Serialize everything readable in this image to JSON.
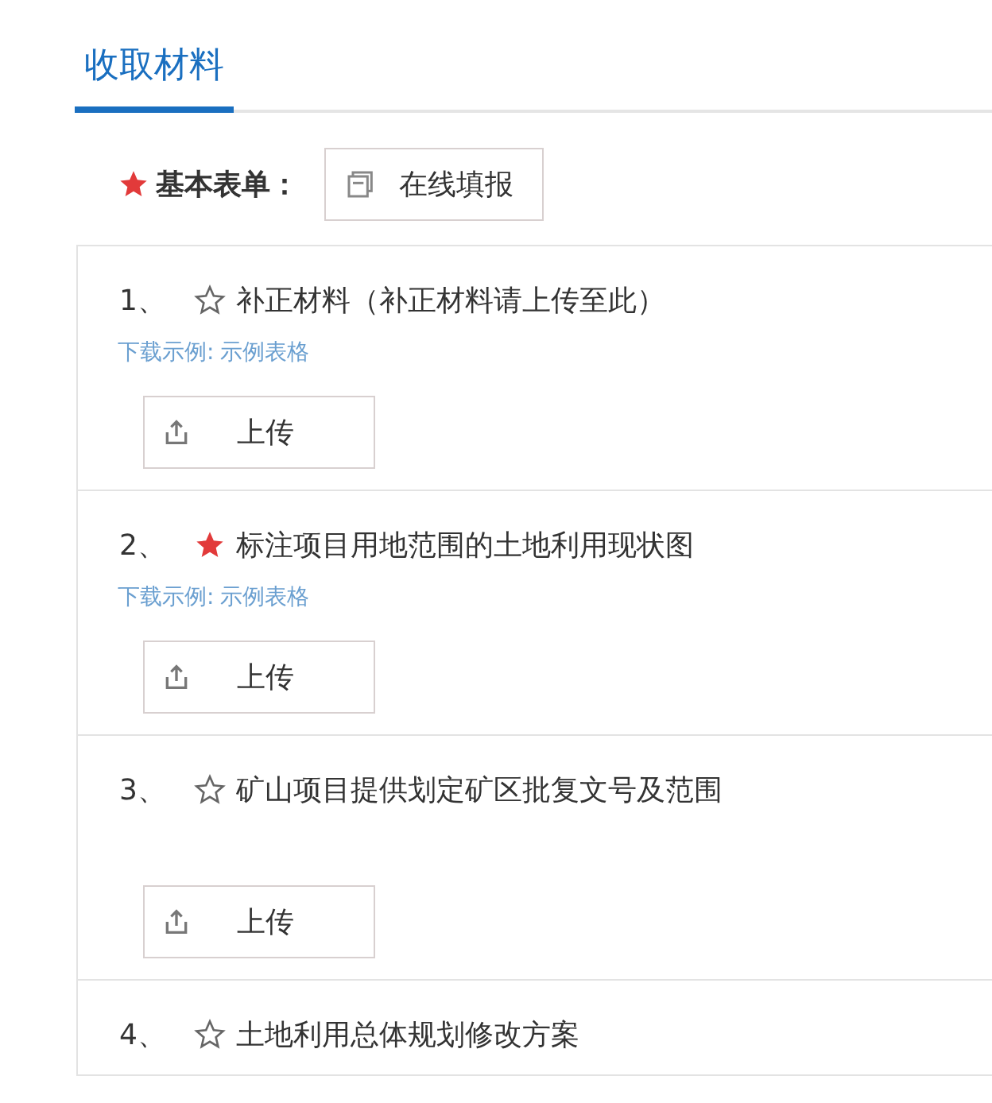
{
  "tabs": [
    {
      "label": "收取材料",
      "selected": true
    }
  ],
  "basic_form": {
    "required": true,
    "label": "基本表单：",
    "button": "在线填报"
  },
  "materials": [
    {
      "number": "1、",
      "required": false,
      "title": "补正材料（补正材料请上传至此）",
      "sample": {
        "label": "下载示例:",
        "link": "示例表格"
      },
      "upload": "上传"
    },
    {
      "number": "2、",
      "required": true,
      "title": "标注项目用地范围的土地利用现状图",
      "sample": {
        "label": "下载示例:",
        "link": "示例表格"
      },
      "upload": "上传"
    },
    {
      "number": "3、",
      "required": false,
      "title": "矿山项目提供划定矿区批复文号及范围",
      "upload": "上传"
    },
    {
      "number": "4、",
      "required": false,
      "title": "土地利用总体规划修改方案"
    }
  ]
}
